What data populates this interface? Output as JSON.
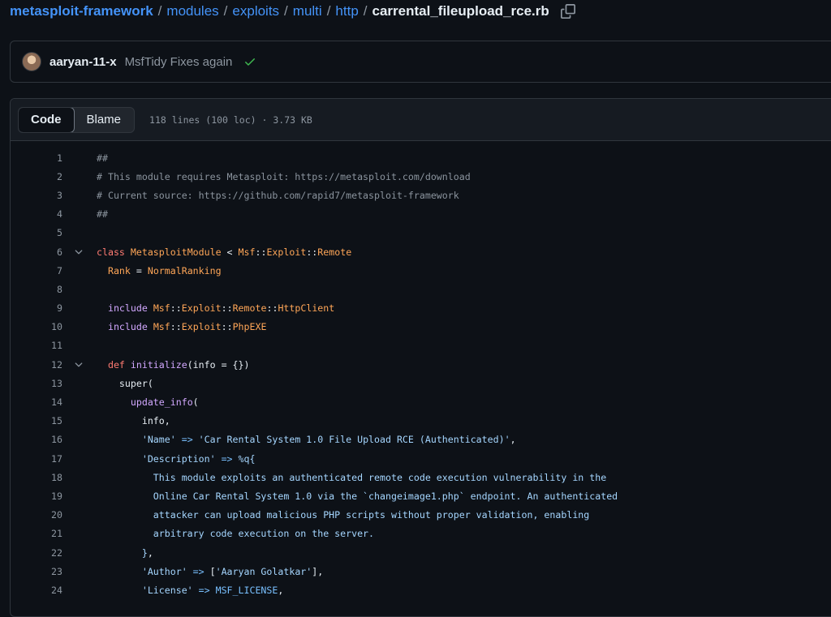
{
  "breadcrumb": {
    "repo": "metasploit-framework",
    "segments": [
      "modules",
      "exploits",
      "multi",
      "http"
    ],
    "file": "carrental_fileupload_rce.rb",
    "separator": "/"
  },
  "commit": {
    "author": "aaryan-11-x",
    "message": "MsfTidy Fixes again",
    "status": "success"
  },
  "file_header": {
    "tabs": [
      "Code",
      "Blame"
    ],
    "active_tab": "Code",
    "meta": "118 lines (100 loc) · 3.73 KB"
  },
  "icons": {
    "copy": "copy-icon",
    "check": "check-icon",
    "fold": "chevron-down-icon"
  },
  "colors": {
    "background": "#0d1117",
    "border": "#30363d",
    "link": "#4493f8",
    "success": "#3fb950",
    "comment": "#8b949e",
    "keyword": "#ff7b72",
    "constant": "#ffa657",
    "function": "#d2a8ff",
    "operator": "#79c0ff",
    "string": "#a5d6ff"
  },
  "code_lines": [
    {
      "n": "1",
      "fold": false,
      "tokens": [
        [
          "c",
          "##"
        ]
      ]
    },
    {
      "n": "2",
      "fold": false,
      "tokens": [
        [
          "c",
          "# This module requires Metasploit: https://metasploit.com/download"
        ]
      ]
    },
    {
      "n": "3",
      "fold": false,
      "tokens": [
        [
          "c",
          "# Current source: https://github.com/rapid7/metasploit-framework"
        ]
      ]
    },
    {
      "n": "4",
      "fold": false,
      "tokens": [
        [
          "c",
          "##"
        ]
      ]
    },
    {
      "n": "5",
      "fold": false,
      "tokens": []
    },
    {
      "n": "6",
      "fold": true,
      "tokens": [
        [
          "k",
          "class "
        ],
        [
          "cl",
          "MetasploitModule"
        ],
        [
          "n",
          " < "
        ],
        [
          "cl",
          "Msf"
        ],
        [
          "n",
          "::"
        ],
        [
          "cl",
          "Exploit"
        ],
        [
          "n",
          "::"
        ],
        [
          "cl",
          "Remote"
        ]
      ]
    },
    {
      "n": "7",
      "fold": false,
      "tokens": [
        [
          "n",
          "  "
        ],
        [
          "cl",
          "Rank"
        ],
        [
          "n",
          " = "
        ],
        [
          "cl",
          "NormalRanking"
        ]
      ]
    },
    {
      "n": "8",
      "fold": false,
      "tokens": []
    },
    {
      "n": "9",
      "fold": false,
      "tokens": [
        [
          "n",
          "  "
        ],
        [
          "fn",
          "include "
        ],
        [
          "cl",
          "Msf"
        ],
        [
          "n",
          "::"
        ],
        [
          "cl",
          "Exploit"
        ],
        [
          "n",
          "::"
        ],
        [
          "cl",
          "Remote"
        ],
        [
          "n",
          "::"
        ],
        [
          "cl",
          "HttpClient"
        ]
      ]
    },
    {
      "n": "10",
      "fold": false,
      "tokens": [
        [
          "n",
          "  "
        ],
        [
          "fn",
          "include "
        ],
        [
          "cl",
          "Msf"
        ],
        [
          "n",
          "::"
        ],
        [
          "cl",
          "Exploit"
        ],
        [
          "n",
          "::"
        ],
        [
          "cl",
          "PhpEXE"
        ]
      ]
    },
    {
      "n": "11",
      "fold": false,
      "tokens": []
    },
    {
      "n": "12",
      "fold": true,
      "tokens": [
        [
          "n",
          "  "
        ],
        [
          "k",
          "def "
        ],
        [
          "fn",
          "initialize"
        ],
        [
          "n",
          "(info = {})"
        ]
      ]
    },
    {
      "n": "13",
      "fold": false,
      "tokens": [
        [
          "n",
          "    super("
        ]
      ]
    },
    {
      "n": "14",
      "fold": false,
      "tokens": [
        [
          "n",
          "      "
        ],
        [
          "fn",
          "update_info"
        ],
        [
          "n",
          "("
        ]
      ]
    },
    {
      "n": "15",
      "fold": false,
      "tokens": [
        [
          "n",
          "        info,"
        ]
      ]
    },
    {
      "n": "16",
      "fold": false,
      "tokens": [
        [
          "n",
          "        "
        ],
        [
          "s",
          "'Name'"
        ],
        [
          "op",
          " => "
        ],
        [
          "s",
          "'Car Rental System 1.0 File Upload RCE (Authenticated)'"
        ],
        [
          "n",
          ","
        ]
      ]
    },
    {
      "n": "17",
      "fold": false,
      "tokens": [
        [
          "n",
          "        "
        ],
        [
          "s",
          "'Description'"
        ],
        [
          "op",
          " => "
        ],
        [
          "s",
          "%q{"
        ]
      ]
    },
    {
      "n": "18",
      "fold": false,
      "tokens": [
        [
          "s",
          "          This module exploits an authenticated remote code execution vulnerability in the"
        ]
      ]
    },
    {
      "n": "19",
      "fold": false,
      "tokens": [
        [
          "s",
          "          Online Car Rental System 1.0 via the `changeimage1.php` endpoint. An authenticated"
        ]
      ]
    },
    {
      "n": "20",
      "fold": false,
      "tokens": [
        [
          "s",
          "          attacker can upload malicious PHP scripts without proper validation, enabling"
        ]
      ]
    },
    {
      "n": "21",
      "fold": false,
      "tokens": [
        [
          "s",
          "          arbitrary code execution on the server."
        ]
      ]
    },
    {
      "n": "22",
      "fold": false,
      "tokens": [
        [
          "s",
          "        }"
        ],
        [
          "n",
          ","
        ]
      ]
    },
    {
      "n": "23",
      "fold": false,
      "tokens": [
        [
          "n",
          "        "
        ],
        [
          "s",
          "'Author'"
        ],
        [
          "op",
          " => "
        ],
        [
          "n",
          "["
        ],
        [
          "s",
          "'Aaryan Golatkar'"
        ],
        [
          "n",
          "],"
        ]
      ]
    },
    {
      "n": "24",
      "fold": false,
      "tokens": [
        [
          "n",
          "        "
        ],
        [
          "s",
          "'License'"
        ],
        [
          "op",
          " => "
        ],
        [
          "op",
          "MSF_LICENSE"
        ],
        [
          "n",
          ","
        ]
      ]
    }
  ]
}
